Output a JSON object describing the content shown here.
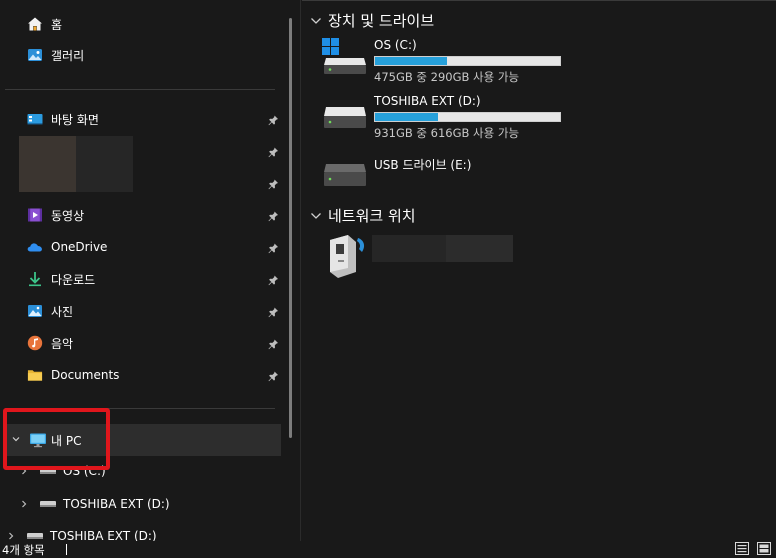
{
  "sidebar": {
    "quick": [
      {
        "label": "홈",
        "icon": "home-icon"
      },
      {
        "label": "갤러리",
        "icon": "gallery-icon"
      }
    ],
    "pinned": [
      {
        "label": "바탕 화면",
        "icon": "desktop-icon"
      },
      {
        "label": "동영상",
        "icon": "videos-icon"
      },
      {
        "label": "OneDrive",
        "icon": "onedrive-icon"
      },
      {
        "label": "다운로드",
        "icon": "downloads-icon"
      },
      {
        "label": "사진",
        "icon": "pictures-icon"
      },
      {
        "label": "음악",
        "icon": "music-icon"
      },
      {
        "label": "Documents",
        "icon": "documents-folder-icon"
      }
    ],
    "this_pc": {
      "label": "내 PC",
      "icon": "this-pc-icon"
    },
    "tree": [
      {
        "label": "OS (C:)"
      },
      {
        "label": "TOSHIBA EXT (D:)"
      },
      {
        "label": "TOSHIBA EXT (D:)"
      }
    ]
  },
  "main": {
    "devices_header": "장치 및 드라이브",
    "drives": [
      {
        "name": "OS (C:)",
        "free_text": "475GB 중 290GB 사용 가능",
        "used_fraction": 0.39
      },
      {
        "name": "TOSHIBA EXT (D:)",
        "free_text": "931GB 중 616GB 사용 가능",
        "used_fraction": 0.34
      },
      {
        "name": "USB 드라이브 (E:)",
        "free_text": "",
        "used_fraction": null
      }
    ],
    "network_header": "네트워크 위치"
  },
  "status": {
    "item_count": "4개 항목"
  },
  "colors": {
    "accent": "#26a0da",
    "highlight": "#e0161c"
  }
}
